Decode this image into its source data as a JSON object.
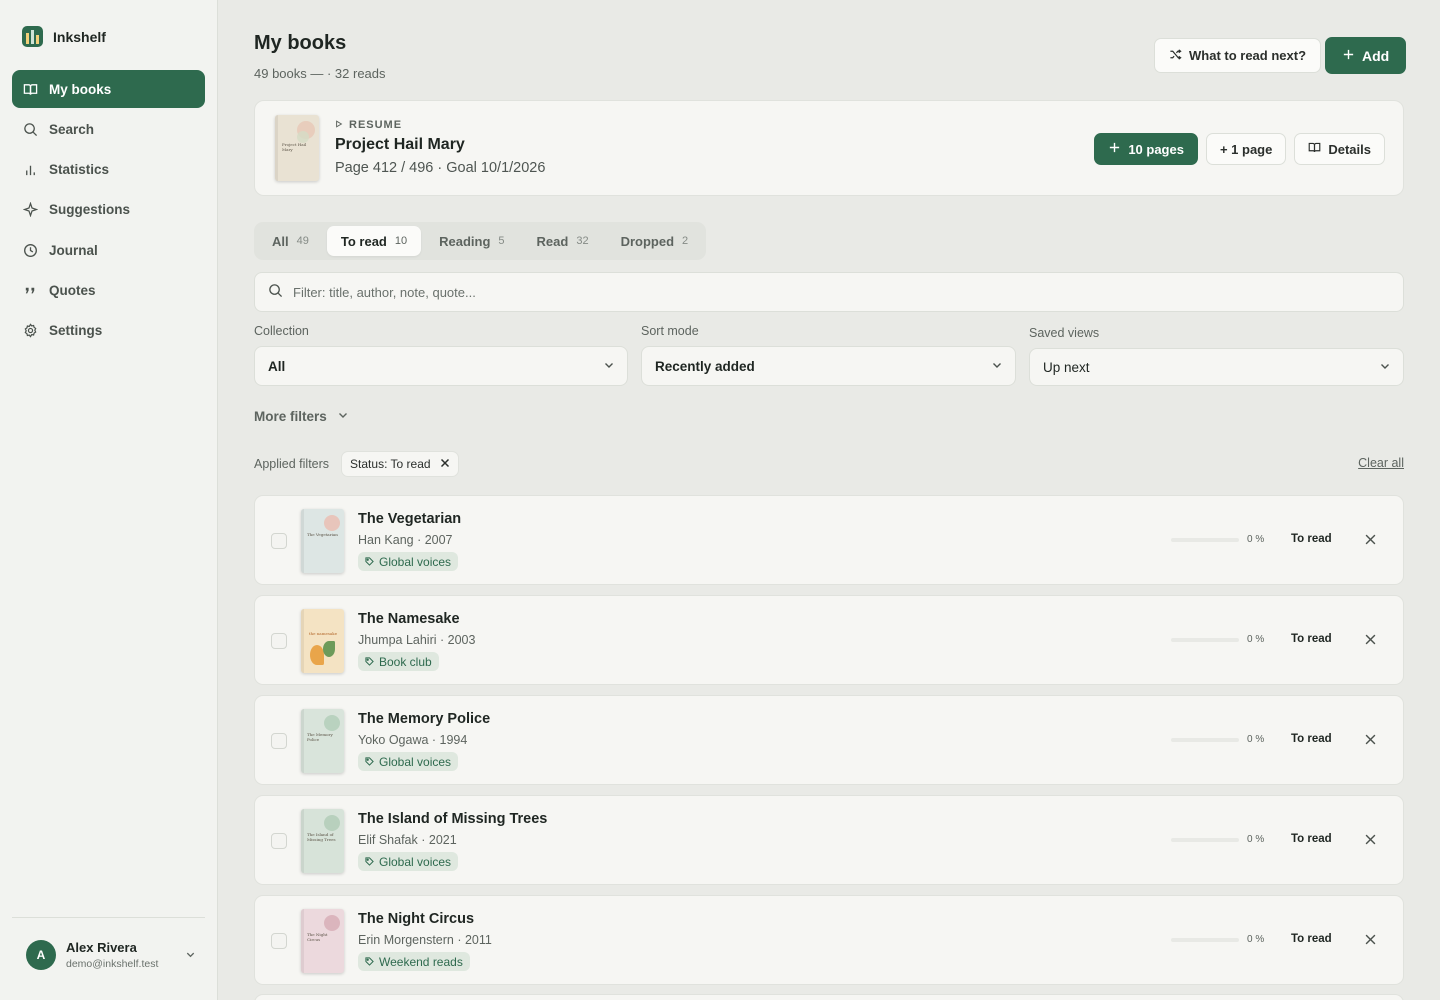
{
  "app": {
    "name": "Inkshelf"
  },
  "sidebar": {
    "items": [
      {
        "label": "My books",
        "icon": "book-open-icon"
      },
      {
        "label": "Search",
        "icon": "search-icon"
      },
      {
        "label": "Statistics",
        "icon": "bar-chart-icon"
      },
      {
        "label": "Suggestions",
        "icon": "sparkle-icon"
      },
      {
        "label": "Journal",
        "icon": "clock-icon"
      },
      {
        "label": "Quotes",
        "icon": "quote-icon"
      },
      {
        "label": "Settings",
        "icon": "gear-icon"
      }
    ],
    "active_index": 0,
    "user": {
      "initial": "A",
      "name": "Alex Rivera",
      "email": "demo@inkshelf.test"
    }
  },
  "header": {
    "title": "My books",
    "subtitle": "49 books — · 32 reads",
    "what_next_label": "What to read next?",
    "add_label": "Add"
  },
  "resume": {
    "kicker": "RESUME",
    "title": "Project Hail Mary",
    "meta": "Page 412 / 496 · Goal 10/1/2026",
    "cover_text": "Project Hail Mary",
    "add_pages_label": "10 pages",
    "add_page_label": "+ 1 page",
    "details_label": "Details"
  },
  "tabs": [
    {
      "label": "All",
      "count": "49"
    },
    {
      "label": "To read",
      "count": "10"
    },
    {
      "label": "Reading",
      "count": "5"
    },
    {
      "label": "Read",
      "count": "32"
    },
    {
      "label": "Dropped",
      "count": "2"
    }
  ],
  "active_tab": 1,
  "search": {
    "placeholder": "Filter: title, author, note, quote..."
  },
  "filters": {
    "collection": {
      "label": "Collection",
      "value": "All"
    },
    "sort": {
      "label": "Sort mode",
      "value": "Recently added"
    },
    "saved_views": {
      "label": "Saved views",
      "value": "Up next"
    },
    "more_label": "More filters",
    "applied_label": "Applied filters",
    "applied": [
      "Status: To read"
    ],
    "clear_all_label": "Clear all"
  },
  "books": [
    {
      "title": "The Vegetarian",
      "meta": "Han Kang · 2007",
      "tag": "Global voices",
      "progress": 0,
      "pct_label": "0 %",
      "status": "To read",
      "cover_text": "The Vegetarian",
      "cover_bg": "#dde6e4",
      "cover_dot": "#e8c5bb"
    },
    {
      "title": "The Namesake",
      "meta": "Jhumpa Lahiri · 2003",
      "tag": "Book club",
      "progress": 0,
      "pct_label": "0 %",
      "status": "To read",
      "cover_text": "the namesake",
      "cover_bg": "#f4e3c3",
      "cover_dot": "#e9a54a"
    },
    {
      "title": "The Memory Police",
      "meta": "Yoko Ogawa · 1994",
      "tag": "Global voices",
      "progress": 0,
      "pct_label": "0 %",
      "status": "To read",
      "cover_text": "The Memory Police",
      "cover_bg": "#d9e4db",
      "cover_dot": "#b9d2bf"
    },
    {
      "title": "The Island of Missing Trees",
      "meta": "Elif Shafak · 2021",
      "tag": "Global voices",
      "progress": 0,
      "pct_label": "0 %",
      "status": "To read",
      "cover_text": "The Island of Missing Trees",
      "cover_bg": "#d7e3d9",
      "cover_dot": "#b8d0bd"
    },
    {
      "title": "The Night Circus",
      "meta": "Erin Morgenstern · 2011",
      "tag": "Weekend reads",
      "progress": 0,
      "pct_label": "0 %",
      "status": "To read",
      "cover_text": "The Night Circus",
      "cover_bg": "#ecd9dd",
      "cover_dot": "#dbb5bd"
    }
  ],
  "colors": {
    "accent": "#2e6a4e",
    "background": "#e9eae6",
    "card": "#f6f6f3",
    "tag_bg": "#dfe8df"
  }
}
